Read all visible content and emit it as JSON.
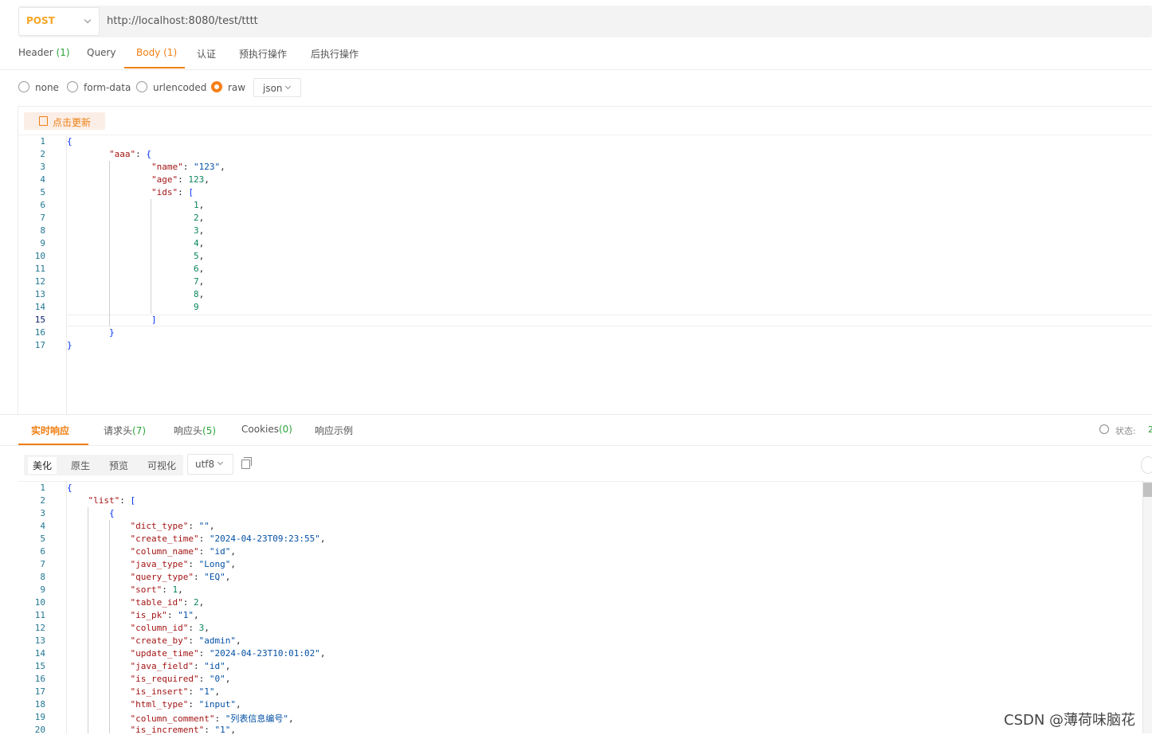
{
  "request": {
    "method": "POST",
    "url": "http://localhost:8080/test/tttt"
  },
  "request_tabs": [
    {
      "label": "Header",
      "count": "(1)"
    },
    {
      "label": "Query",
      "count": ""
    },
    {
      "label": "Body",
      "count": "(1)"
    },
    {
      "label": "认证",
      "count": ""
    },
    {
      "label": "预执行操作",
      "count": ""
    },
    {
      "label": "后执行操作",
      "count": ""
    }
  ],
  "active_request_tab": "Body",
  "body_types": [
    "none",
    "form-data",
    "urlencoded",
    "raw"
  ],
  "selected_body_type": "raw",
  "body_format": "json",
  "refresh_label": "点击更新",
  "request_body_lines": [
    "{",
    "        \"aaa\": {",
    "                \"name\": \"123\",",
    "                \"age\": 123,",
    "                \"ids\": [",
    "                        1,",
    "                        2,",
    "                        3,",
    "                        4,",
    "                        5,",
    "                        6,",
    "                        7,",
    "                        8,",
    "                        9",
    "                ]",
    "        }",
    "}"
  ],
  "request_current_line": 15,
  "response_tabs": [
    {
      "label": "实时响应",
      "count": ""
    },
    {
      "label": "请求头",
      "count": "(7)"
    },
    {
      "label": "响应头",
      "count": "(5)"
    },
    {
      "label": "Cookies",
      "count": "(0)"
    },
    {
      "label": "响应示例",
      "count": ""
    }
  ],
  "active_response_tab": "实时响应",
  "status_label": "状态:",
  "status_value": "2",
  "view_modes": [
    "美化",
    "原生",
    "预览",
    "可视化"
  ],
  "active_view_mode": "美化",
  "encoding": "utf8",
  "response_body_lines": [
    "{",
    "    \"list\": [",
    "        {",
    "            \"dict_type\": \"\",",
    "            \"create_time\": \"2024-04-23T09:23:55\",",
    "            \"column_name\": \"id\",",
    "            \"java_type\": \"Long\",",
    "            \"query_type\": \"EQ\",",
    "            \"sort\": 1,",
    "            \"table_id\": 2,",
    "            \"is_pk\": \"1\",",
    "            \"column_id\": 3,",
    "            \"create_by\": \"admin\",",
    "            \"update_time\": \"2024-04-23T10:01:02\",",
    "            \"java_field\": \"id\",",
    "            \"is_required\": \"0\",",
    "            \"is_insert\": \"1\",",
    "            \"html_type\": \"input\",",
    "            \"column_comment\": \"列表信息编号\",",
    "            \"is_increment\": \"1\","
  ],
  "watermark": "CSDN @薄荷味脑花",
  "colors": {
    "accent": "#f07f13",
    "count_green": "#2ea33b",
    "method": "#f5a623"
  }
}
